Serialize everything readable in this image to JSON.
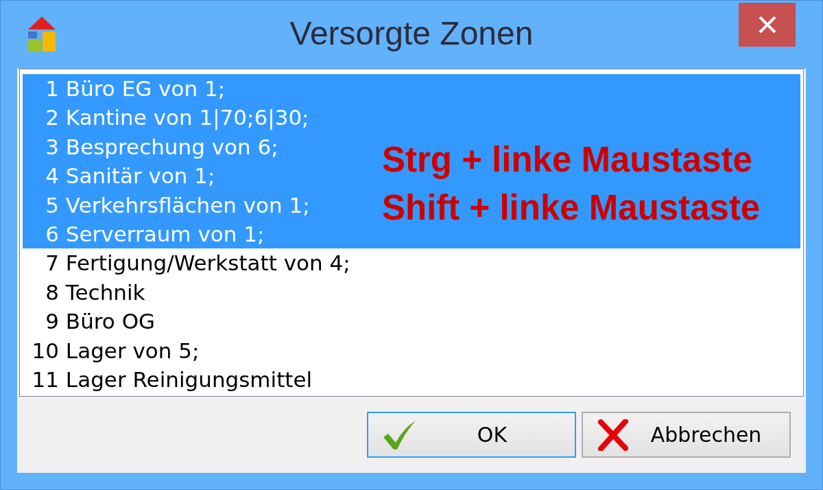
{
  "window": {
    "title": "Versorgte Zonen"
  },
  "zones": [
    {
      "number": "1",
      "name": "Büro EG von 1;",
      "selected": true
    },
    {
      "number": "2",
      "name": "Kantine von 1|70;6|30;",
      "selected": true
    },
    {
      "number": "3",
      "name": "Besprechung von 6;",
      "selected": true
    },
    {
      "number": "4",
      "name": "Sanitär von 1;",
      "selected": true
    },
    {
      "number": "5",
      "name": "Verkehrsflächen von 1;",
      "selected": true
    },
    {
      "number": "6",
      "name": "Serverraum von 1;",
      "selected": true
    },
    {
      "number": "7",
      "name": "Fertigung/Werkstatt von 4;",
      "selected": false
    },
    {
      "number": "8",
      "name": "Technik",
      "selected": false
    },
    {
      "number": "9",
      "name": "Büro OG",
      "selected": false
    },
    {
      "number": "10",
      "name": "Lager von 5;",
      "selected": false
    },
    {
      "number": "11",
      "name": "Lager Reinigungsmittel",
      "selected": false
    }
  ],
  "annotations": [
    "Strg + linke Maustaste",
    "Shift + linke Maustaste"
  ],
  "buttons": [
    {
      "label": "OK",
      "kind": "confirm",
      "focused": true
    },
    {
      "label": "Abbrechen",
      "kind": "cancel",
      "focused": false
    }
  ]
}
